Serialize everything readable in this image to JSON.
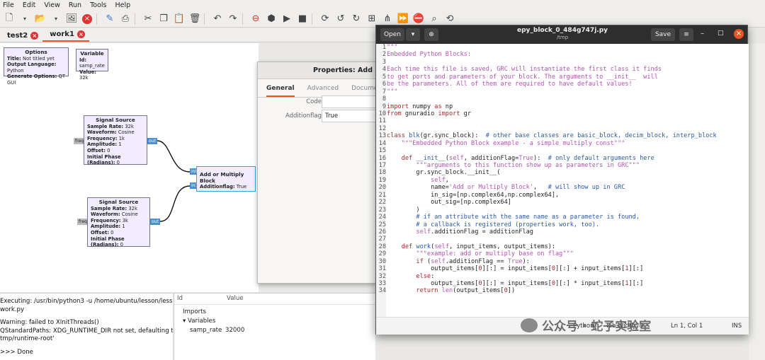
{
  "menubar": [
    "File",
    "Edit",
    "View",
    "Run",
    "Tools",
    "Help"
  ],
  "tabs": [
    {
      "label": "test2"
    },
    {
      "label": "work1"
    }
  ],
  "options_block": {
    "title": "Options",
    "lines": [
      [
        "Title:",
        "Not titled yet"
      ],
      [
        "Output Language:",
        "Python"
      ],
      [
        "Generate Options:",
        "QT GUI"
      ]
    ]
  },
  "variable_block": {
    "title": "Variable",
    "lines": [
      [
        "Id:",
        "samp_rate"
      ],
      [
        "Value:",
        "32k"
      ]
    ]
  },
  "signal_source_1": {
    "title": "Signal Source",
    "lines": [
      [
        "Sample Rate:",
        "32k"
      ],
      [
        "Waveform:",
        "Cosine"
      ],
      [
        "Frequency:",
        "1k"
      ],
      [
        "Amplitude:",
        "1"
      ],
      [
        "Offset:",
        "0"
      ],
      [
        "Initial Phase (Radians):",
        "0"
      ]
    ],
    "in_port": "freq",
    "out_port": "out"
  },
  "signal_source_2": {
    "title": "Signal Source",
    "lines": [
      [
        "Sample Rate:",
        "32k"
      ],
      [
        "Waveform:",
        "Cosine"
      ],
      [
        "Frequency:",
        "3k"
      ],
      [
        "Amplitude:",
        "1"
      ],
      [
        "Offset:",
        "0"
      ],
      [
        "Initial Phase (Radians):",
        "0"
      ]
    ],
    "in_port": "freq",
    "out_port": "out"
  },
  "add_block": {
    "title": "Add or Multiply Block",
    "param": "Additionflag:",
    "value": "True",
    "in0": "in0",
    "in1": "in1"
  },
  "properties": {
    "title": "Properties: Add",
    "tabs": [
      "General",
      "Advanced",
      "Document"
    ],
    "rows": [
      {
        "label": "Code",
        "value": ""
      },
      {
        "label": "Additionflag",
        "value": "True"
      }
    ]
  },
  "console": {
    "lines": [
      "Executing: /usr/bin/python3 -u /home/ubuntu/lesson/lesson4/-",
      "work.py",
      "",
      "Warning: failed to XInitThreads()",
      "QStandardPaths: XDG_RUNTIME_DIR not set, defaulting to '/-",
      "tmp/runtime-root'",
      "",
      ">>> Done"
    ]
  },
  "variables_panel": {
    "col_id": "Id",
    "col_value": "Value",
    "imports": "Imports",
    "variables": "Variables",
    "var_name": "samp_rate",
    "var_value": "32000"
  },
  "editor": {
    "open_label": "Open",
    "filename": "epy_block_0_484g747j.py",
    "path": "/tmp",
    "save_label": "Save",
    "status_lang": "Python",
    "status_tab": "Tab Width: 8",
    "status_pos": "Ln 1, Col 1",
    "status_ins": "INS"
  },
  "watermark": "公众号 · 蛇子实验室",
  "colors": {
    "accent": "#e95420",
    "block_bg": "#f1ecff",
    "port": "#4a90d9"
  }
}
